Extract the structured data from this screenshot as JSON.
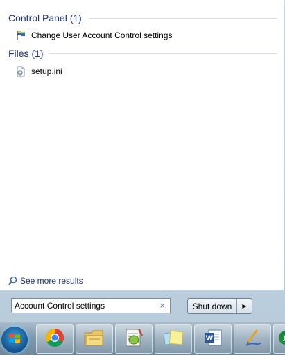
{
  "results": {
    "groups": [
      {
        "header": "Control Panel (1)",
        "items": [
          {
            "label": "Change User Account Control settings",
            "icon": "uac-flag-icon"
          }
        ]
      },
      {
        "header": "Files (1)",
        "items": [
          {
            "label": "setup.ini",
            "icon": "ini-file-icon"
          }
        ]
      }
    ],
    "see_more": "See more results"
  },
  "search": {
    "value": "Account Control settings",
    "clear_icon": "×"
  },
  "shutdown": {
    "label": "Shut down",
    "arrow": "▶"
  },
  "taskbar": {
    "items": [
      {
        "name": "start-orb",
        "icon": "windows-logo-icon"
      },
      {
        "name": "chrome",
        "icon": "chrome-icon"
      },
      {
        "name": "file-explorer",
        "icon": "folder-icon"
      },
      {
        "name": "notepad-plus",
        "icon": "notepad-plus-icon"
      },
      {
        "name": "sticky-notes",
        "icon": "sticky-notes-icon"
      },
      {
        "name": "word",
        "icon": "word-icon"
      },
      {
        "name": "inkscape",
        "icon": "pen-icon"
      },
      {
        "name": "excel",
        "icon": "excel-icon"
      }
    ]
  },
  "colors": {
    "group_header": "#1e3287",
    "taskbar": "#7f98ab"
  }
}
